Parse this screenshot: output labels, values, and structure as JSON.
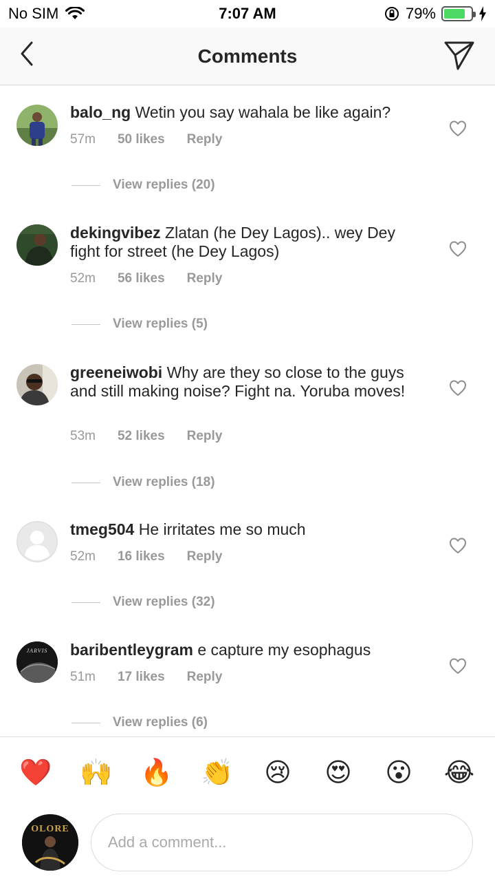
{
  "status_bar": {
    "carrier": "No SIM",
    "time": "7:07 AM",
    "battery_percent": "79%",
    "battery_level": 0.79,
    "icons": [
      "wifi-icon",
      "orientation-lock-icon",
      "battery-icon",
      "charging-bolt-icon"
    ]
  },
  "header": {
    "title": "Comments",
    "back_icon": "chevron-left-icon",
    "send_icon": "paper-plane-icon"
  },
  "comments": [
    {
      "username": "balo_ng",
      "text": "Wetin you say wahala be like again?",
      "time": "57m",
      "likes": "50 likes",
      "reply": "Reply",
      "view_replies": "View replies (20)"
    },
    {
      "username": "dekingvibez",
      "text": "Zlatan (he Dey Lagos).. wey Dey fight for street (he Dey Lagos)",
      "time": "52m",
      "likes": "56 likes",
      "reply": "Reply",
      "view_replies": "View replies (5)"
    },
    {
      "username": "greeneiwobi",
      "text": "Why are they so close to the guys and still making noise? Fight na. Yoruba moves!",
      "time": "53m",
      "likes": "52 likes",
      "reply": "Reply",
      "view_replies": "View replies (18)"
    },
    {
      "username": "tmeg504",
      "text": "He irritates me so much",
      "time": "52m",
      "likes": "16 likes",
      "reply": "Reply",
      "view_replies": "View replies (32)"
    },
    {
      "username": "baribentleygram",
      "text": "e capture my esophagus",
      "time": "51m",
      "likes": "17 likes",
      "reply": "Reply",
      "view_replies": "View replies (6)",
      "avatar_text": "JARVIS"
    }
  ],
  "emoji_bar": [
    "❤️",
    "🙌",
    "🔥",
    "👏",
    "😢",
    "😍",
    "😮",
    "😂"
  ],
  "composer": {
    "placeholder": "Add a comment...",
    "avatar_text": "OLORE"
  },
  "colors": {
    "text": "#262626",
    "meta": "#999999",
    "header_bg": "#f9f9f9",
    "battery": "#4cd964"
  }
}
